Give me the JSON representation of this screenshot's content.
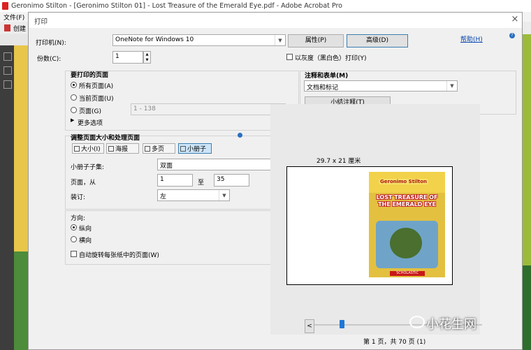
{
  "app": {
    "title": "Geronimo Stilton - [Geronimo Stilton 01] - Lost Treasure of the Emerald Eye.pdf - Adobe Acrobat Pro",
    "menu_file": "文件(F)",
    "create_label": "创建"
  },
  "dialog": {
    "title": "打印",
    "printer": {
      "label": "打印机(N):",
      "value": "OneNote for Windows 10",
      "properties_button": "属性(P)",
      "advanced_button": "高级(D)",
      "help_link": "帮助(H)"
    },
    "copies": {
      "label": "份数(C):",
      "value": "1"
    },
    "grayscale": {
      "label": "以灰度（黑白色）打印(Y)",
      "checked": false
    },
    "pages_to_print": {
      "heading": "要打印的页面",
      "all_pages": "所有页面(A)",
      "current_page": "当前页面(U)",
      "pages": "页面(G)",
      "pages_range": "1 - 138",
      "more_options": "更多选项",
      "selected": "all_pages"
    },
    "page_sizing": {
      "heading": "调整页面大小和处理页面",
      "tabs": [
        "大小(I)",
        "海报",
        "多页",
        "小册子"
      ],
      "selected_tab": "小册子",
      "booklet_subset_label": "小册子子集:",
      "booklet_subset_value": "双面",
      "pages_from_label": "页面，从",
      "pages_from_value": "1",
      "to_label": "至",
      "pages_to_value": "35",
      "binding_label": "装订:",
      "binding_value": "左"
    },
    "orientation": {
      "heading": "方向:",
      "portrait": "纵向",
      "landscape": "横向",
      "selected": "portrait",
      "auto_rotate": "自动旋转每张纸中的页面(W)",
      "auto_rotate_checked": false
    },
    "comments_forms": {
      "heading": "注释和表单(M)",
      "value": "文档和标记",
      "summarize_button": "小结注释(T)"
    },
    "preview": {
      "paper_size": "29.7 x 21 厘米",
      "cover_series": "Geronimo Stilton",
      "cover_title": "LOST TREASURE OF THE EMERALD EYE",
      "cover_publisher": "SCHOLASTIC",
      "prev_button": "<",
      "page_status": "第 1 页，共 70 页 (1)",
      "current_page": 1,
      "total_pages": 70
    }
  },
  "watermark": {
    "text": "小花生网"
  }
}
